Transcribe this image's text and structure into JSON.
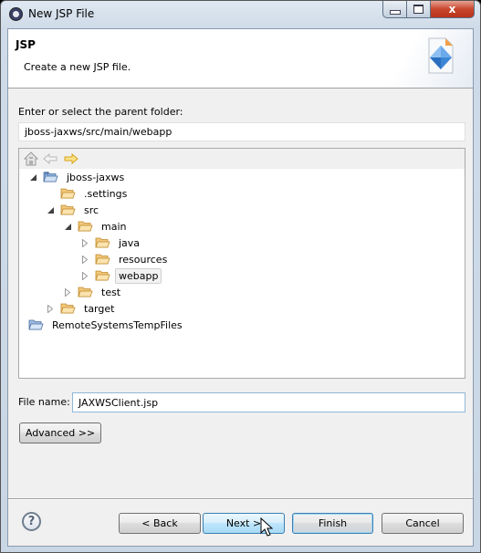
{
  "window": {
    "title": "New JSP File",
    "controls": {
      "minimize": "minimize",
      "maximize": "maximize",
      "close": "x"
    }
  },
  "header": {
    "title": "JSP",
    "description": "Create a new JSP file."
  },
  "parent_folder": {
    "label": "Enter or select the parent folder:",
    "value": "jboss-jaxws/src/main/webapp"
  },
  "tree": {
    "toolbar": [
      "home-icon",
      "back-arrow-icon",
      "forward-arrow-icon"
    ],
    "items": [
      {
        "label": "jboss-jaxws",
        "level": 0,
        "expander": "expanded",
        "icon": "project-icon"
      },
      {
        "label": ".settings",
        "level": 1,
        "expander": "none",
        "icon": "folder-icon"
      },
      {
        "label": "src",
        "level": 1,
        "expander": "expanded",
        "icon": "folder-icon"
      },
      {
        "label": "main",
        "level": 2,
        "expander": "expanded",
        "icon": "folder-icon"
      },
      {
        "label": "java",
        "level": 3,
        "expander": "collapsed",
        "icon": "folder-icon"
      },
      {
        "label": "resources",
        "level": 3,
        "expander": "collapsed",
        "icon": "folder-icon"
      },
      {
        "label": "webapp",
        "level": 3,
        "expander": "collapsed",
        "icon": "folder-icon",
        "selected": true
      },
      {
        "label": "test",
        "level": 2,
        "expander": "collapsed",
        "icon": "folder-icon"
      },
      {
        "label": "target",
        "level": 1,
        "expander": "collapsed",
        "icon": "folder-icon"
      },
      {
        "label": "RemoteSystemsTempFiles",
        "level": 0,
        "expander": "none",
        "icon": "project-folder-icon"
      }
    ]
  },
  "file_name": {
    "label": "File name:",
    "value": "JAXWSClient.jsp"
  },
  "buttons": {
    "advanced": "Advanced >>",
    "back": "< Back",
    "next": "Next >",
    "finish": "Finish",
    "cancel": "Cancel",
    "help": "?"
  }
}
